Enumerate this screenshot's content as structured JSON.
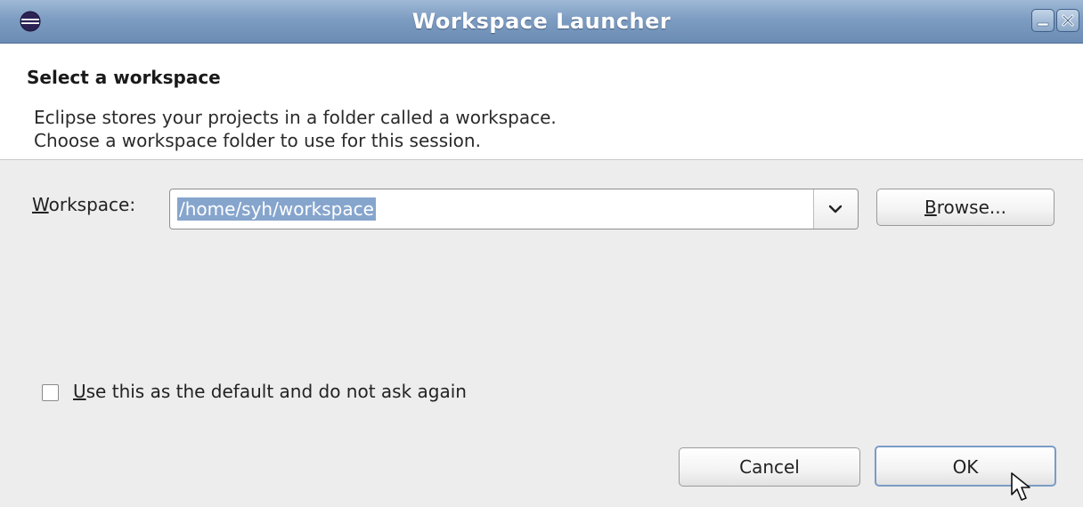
{
  "window": {
    "title": "Workspace Launcher"
  },
  "banner": {
    "title": "Select a workspace",
    "description_line1": "Eclipse stores your projects in a folder called a workspace.",
    "description_line2": "Choose a workspace folder to use for this session."
  },
  "workspace": {
    "label_mnemonic": "W",
    "label_rest": "orkspace:",
    "value": "/home/syh/workspace",
    "browse_mnemonic": "B",
    "browse_rest": "rowse..."
  },
  "default_option": {
    "checked": false,
    "label_mnemonic": "U",
    "label_rest": "se this as the default and do not ask again"
  },
  "buttons": {
    "cancel": "Cancel",
    "ok": "OK"
  },
  "icons": {
    "app": "eclipse-icon",
    "minimize": "minimize-icon",
    "close": "close-icon",
    "dropdown": "chevron-down-icon",
    "cursor": "mouse-cursor-icon"
  }
}
